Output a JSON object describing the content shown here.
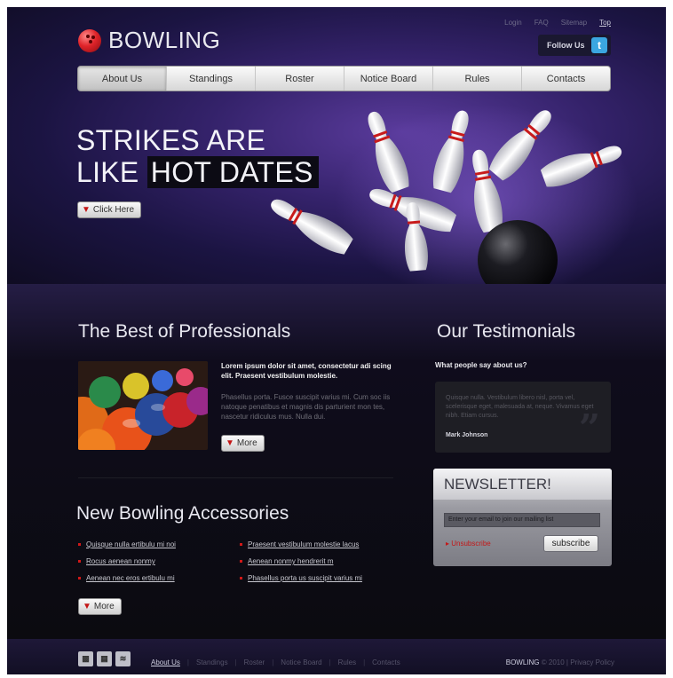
{
  "brand": {
    "name": "BOWLING"
  },
  "header": {
    "top_links": [
      "Login",
      "FAQ",
      "Sitemap",
      "Top"
    ],
    "follow_label": "Follow Us",
    "nav": [
      "About Us",
      "Standings",
      "Roster",
      "Notice Board",
      "Rules",
      "Contacts"
    ],
    "headline_1": "STRIKES ARE",
    "headline_2a": "LIKE",
    "headline_2b": "HOT DATES",
    "cta": "Click Here"
  },
  "professionals": {
    "title": "The Best of Professionals",
    "bold": "Lorem ipsum dolor sit amet, consectetur adi scing elit. Praesent vestibulum molestie.",
    "body": "Phasellus porta. Fusce suscipit varius mi. Cum soc iis natoque penatibus et magnis dis parturient mon tes, nascetur ridiculus mus. Nulla dui.",
    "more": "More"
  },
  "accessories": {
    "title": "New Bowling Accessories",
    "left": [
      "Quisque nulla ertibulu mi noi",
      "Rocus aenean nonmy",
      "Aenean nec eros ertibulu mi"
    ],
    "right": [
      "Praesent vestibulum molestie lacus",
      "Aenean nonmy hendrerit m",
      "Phasellus porta us suscipit varius mi"
    ],
    "more": "More"
  },
  "testimonials": {
    "title": "Our Testimonials",
    "question": "What people say about us?",
    "quote": "Quisque nulla. Vestibulum libero nisl, porta vel, scelerisque eget, malesuada at, neque. Vivamus eget nibh. Etiam cursus.",
    "author": "Mark Johnson"
  },
  "newsletter": {
    "title": "NEWSLETTER!",
    "placeholder": "Enter your email to join our mailing list",
    "unsubscribe": "Unsubscribe",
    "subscribe": "subscribe"
  },
  "footer": {
    "links": [
      "About Us",
      "Standings",
      "Roster",
      "Notice Board",
      "Rules",
      "Contacts"
    ],
    "copyright_brand": "BOWLING",
    "copyright_rest": "© 2010 | Privacy Policy"
  },
  "colors": {
    "accent_red": "#c31414",
    "twitter": "#3ba6e0",
    "header_purple": "#34226a"
  }
}
